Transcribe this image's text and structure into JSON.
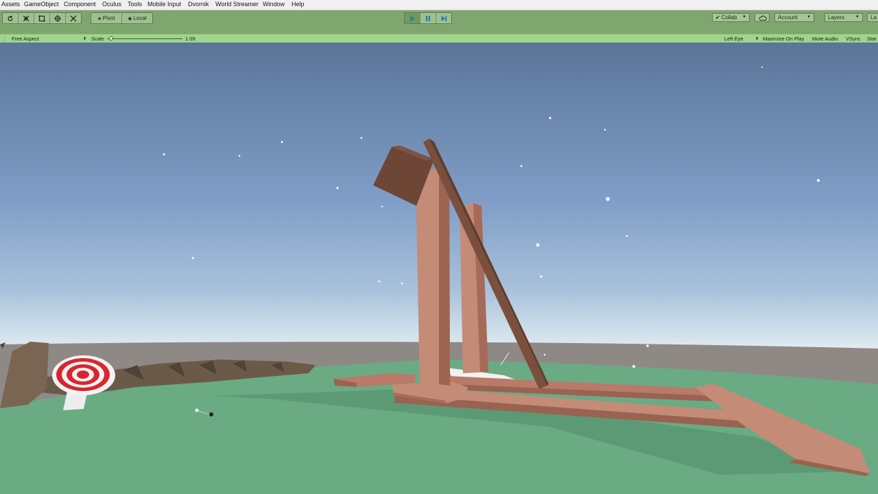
{
  "menu": [
    "Assets",
    "GameObject",
    "Component",
    "Oculus",
    "Tools",
    "Mobile Input",
    "Dvornik",
    "World Streamer",
    "Window",
    "Help"
  ],
  "toolbar": {
    "transform_tools": [
      "rotate-tool-icon",
      "scale-tool-icon",
      "rect-tool-icon",
      "transform-tool-icon",
      "custom-tool-icon"
    ],
    "pivot_label": "Pivot",
    "local_label": "Local",
    "play_controls": [
      "play-icon",
      "pause-icon",
      "step-icon"
    ],
    "collab_label": "Collab",
    "account_label": "Account",
    "layers_label": "Layers",
    "layout_label": "La"
  },
  "game_view": {
    "aspect": "Free Aspect",
    "scale_label": "Scale",
    "scale_value": "1.09",
    "scale_slider_level": 0.05,
    "eye": "Left Eye",
    "maximize_on_play": "Maximize On Play",
    "mute_audio": "Mute Audio",
    "vsync": "VSync",
    "stats": "Stat"
  },
  "colors": {
    "toolbar_play_tint": "#80a66f",
    "gamebar_tint": "#9fd58c",
    "sky_top": "#5a7598",
    "sky_horizon": "#eef3f5",
    "ground": "#6aab84",
    "wood": "#b97a68",
    "dark_wood": "#7a4f3c",
    "target_red": "#d9262e"
  }
}
